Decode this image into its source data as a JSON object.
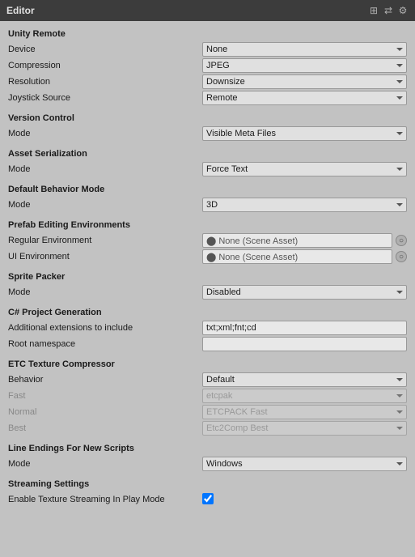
{
  "titleBar": {
    "title": "Editor",
    "icons": [
      "grid-icon",
      "layout-icon",
      "settings-icon"
    ]
  },
  "sections": {
    "unityRemote": {
      "header": "Unity Remote",
      "fields": [
        {
          "label": "Device",
          "type": "select",
          "value": "None",
          "options": [
            "None"
          ]
        },
        {
          "label": "Compression",
          "type": "select",
          "value": "JPEG",
          "options": [
            "JPEG"
          ]
        },
        {
          "label": "Resolution",
          "type": "select",
          "value": "Downsize",
          "options": [
            "Downsize"
          ]
        },
        {
          "label": "Joystick Source",
          "type": "select",
          "value": "Remote",
          "options": [
            "Remote"
          ]
        }
      ]
    },
    "versionControl": {
      "header": "Version Control",
      "fields": [
        {
          "label": "Mode",
          "type": "select",
          "value": "Visible Meta Files",
          "options": [
            "Visible Meta Files"
          ]
        }
      ]
    },
    "assetSerialization": {
      "header": "Asset Serialization",
      "fields": [
        {
          "label": "Mode",
          "type": "select",
          "value": "Force Text",
          "options": [
            "Force Text"
          ]
        }
      ]
    },
    "defaultBehaviorMode": {
      "header": "Default Behavior Mode",
      "fields": [
        {
          "label": "Mode",
          "type": "select",
          "value": "3D",
          "options": [
            "3D"
          ]
        }
      ]
    },
    "prefabEditingEnvironments": {
      "header": "Prefab Editing Environments",
      "fields": [
        {
          "label": "Regular Environment",
          "type": "scene-asset",
          "value": "None (Scene Asset)"
        },
        {
          "label": "UI Environment",
          "type": "scene-asset",
          "value": "None (Scene Asset)"
        }
      ]
    },
    "spritePacker": {
      "header": "Sprite Packer",
      "fields": [
        {
          "label": "Mode",
          "type": "select",
          "value": "Disabled",
          "options": [
            "Disabled"
          ]
        }
      ]
    },
    "csharpProjectGeneration": {
      "header": "C# Project Generation",
      "fields": [
        {
          "label": "Additional extensions to include",
          "type": "text",
          "value": "txt;xml;fnt;cd"
        },
        {
          "label": "Root namespace",
          "type": "text",
          "value": ""
        }
      ]
    },
    "etcTextureCompressor": {
      "header": "ETC Texture Compressor",
      "fields": [
        {
          "label": "Behavior",
          "type": "select",
          "value": "Default",
          "options": [
            "Default"
          ],
          "disabled": false
        },
        {
          "label": "Fast",
          "type": "select",
          "value": "etcpak",
          "options": [
            "etcpak"
          ],
          "disabled": true
        },
        {
          "label": "Normal",
          "type": "select",
          "value": "ETCPACK Fast",
          "options": [
            "ETCPACK Fast"
          ],
          "disabled": true
        },
        {
          "label": "Best",
          "type": "select",
          "value": "Etc2Comp Best",
          "options": [
            "Etc2Comp Best"
          ],
          "disabled": true
        }
      ]
    },
    "lineEndings": {
      "header": "Line Endings For New Scripts",
      "fields": [
        {
          "label": "Mode",
          "type": "select",
          "value": "Windows",
          "options": [
            "Windows"
          ]
        }
      ]
    },
    "streamingSettings": {
      "header": "Streaming Settings",
      "fields": [
        {
          "label": "Enable Texture Streaming In Play Mode",
          "type": "checkbox",
          "value": true
        }
      ]
    }
  }
}
